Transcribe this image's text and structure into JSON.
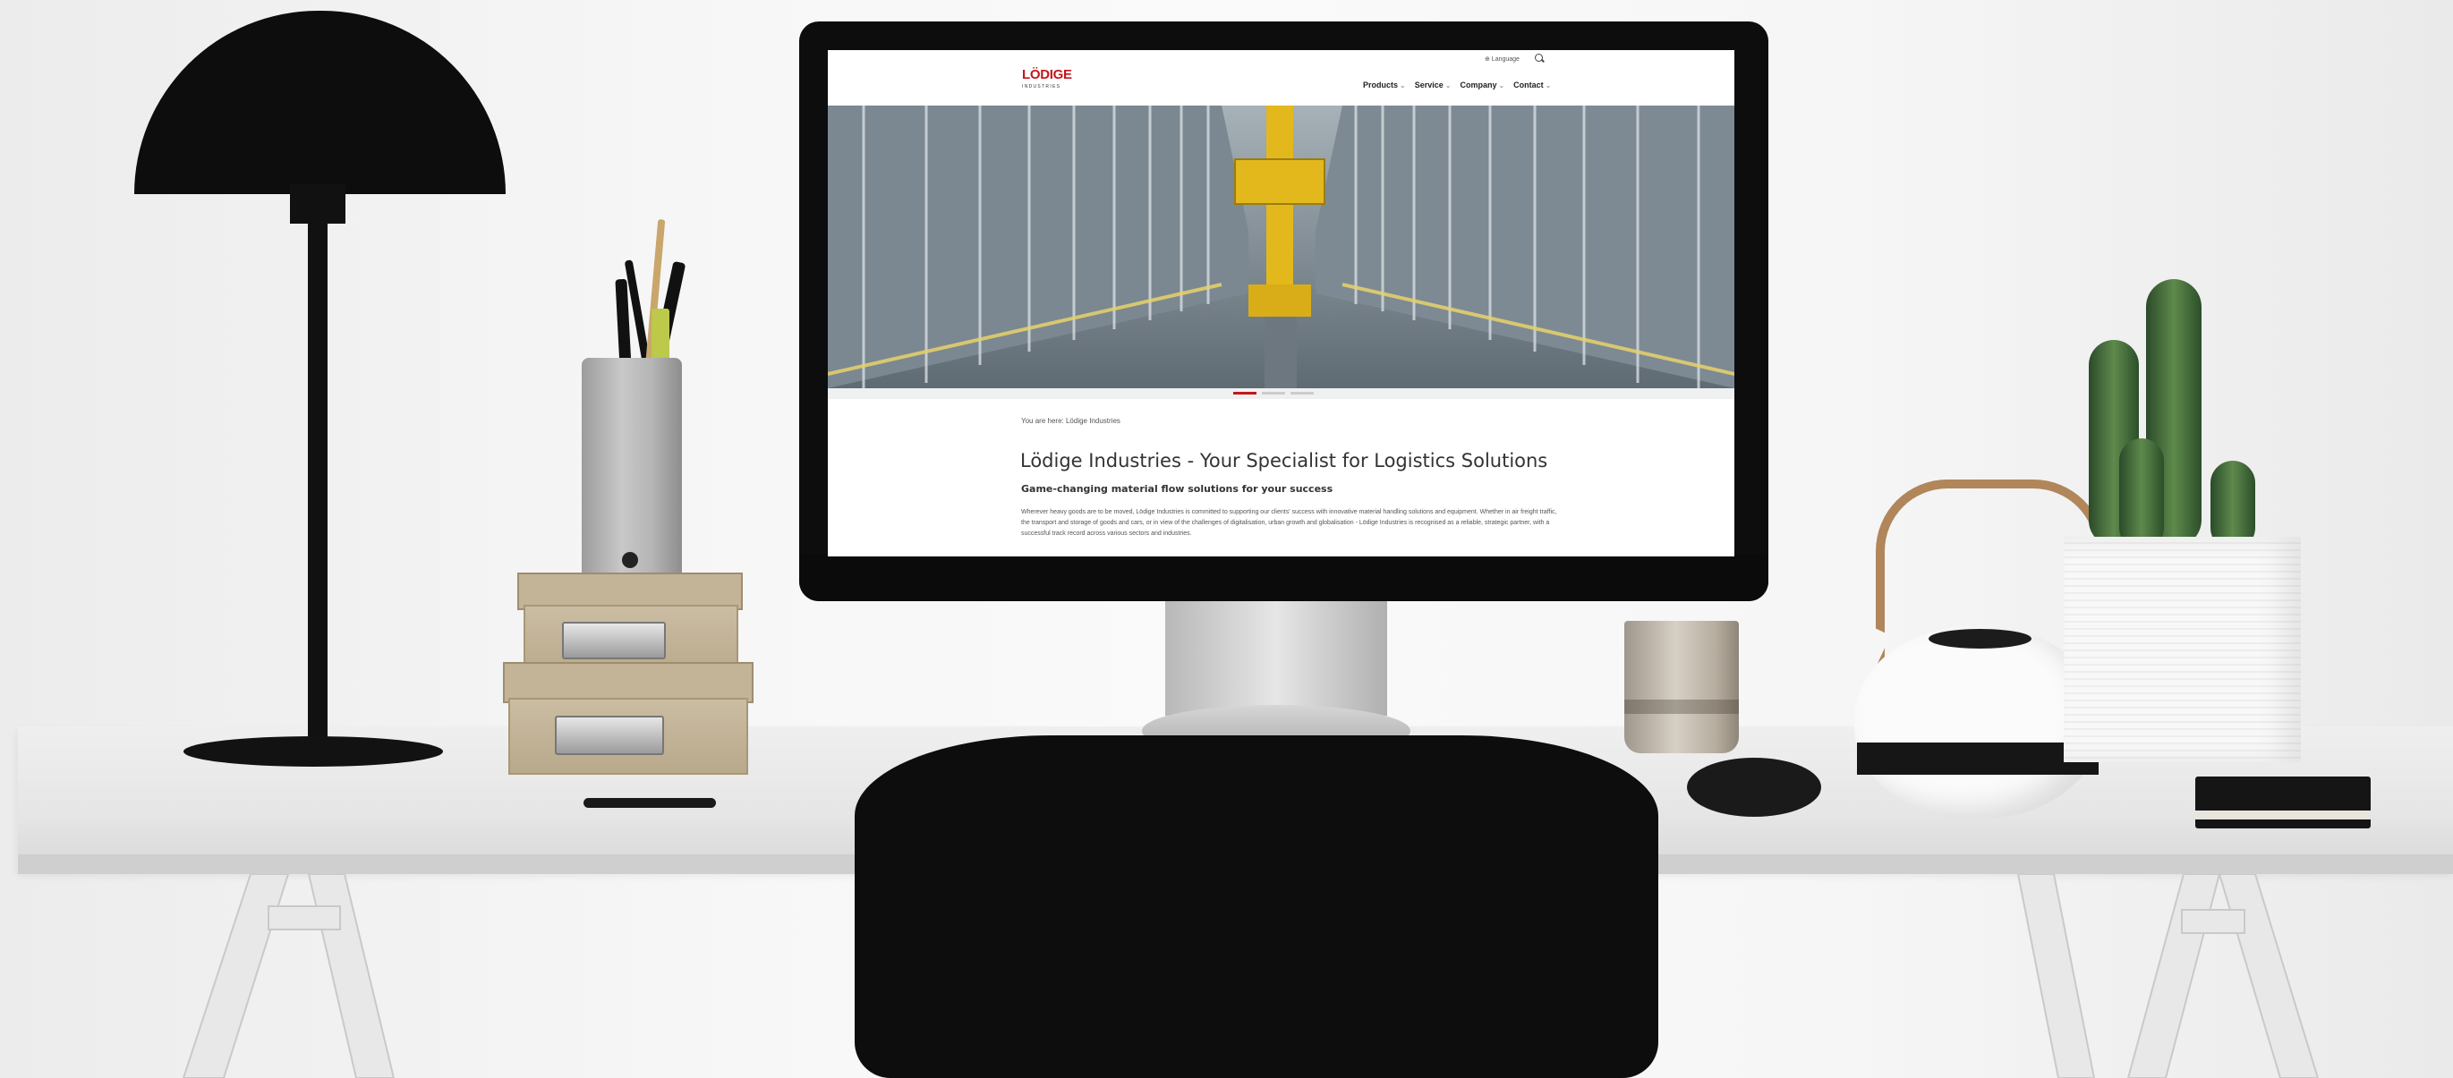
{
  "site": {
    "language_label": "⊕ Language",
    "logo": {
      "name": "LÖDIGE",
      "sub": "INDUSTRIES"
    },
    "nav": [
      {
        "label": "Products"
      },
      {
        "label": "Service"
      },
      {
        "label": "Company"
      },
      {
        "label": "Contact"
      }
    ],
    "nav_chevron": "⌄",
    "breadcrumb": "You are here: Lödige Industries",
    "title": "Lödige Industries - Your Specialist for Logistics Solutions",
    "subtitle": "Game-changing material flow solutions for your success",
    "body": "Wherever heavy goods are to be moved, Lödige Industries is committed to supporting our clients' success with innovative material handling solutions and equipment. Whether in air freight traffic, the transport and storage of goods and cars, or in view of the challenges of digitalisation, urban growth and globalisation - Lödige Industries is recognised as a reliable, strategic partner, with a successful track record across various sectors and industries."
  },
  "colors": {
    "brand_red": "#c4161c",
    "hero_yellow": "#e2b81c",
    "lamp": "#0d0d0d",
    "chair": "#0d0d0d"
  }
}
